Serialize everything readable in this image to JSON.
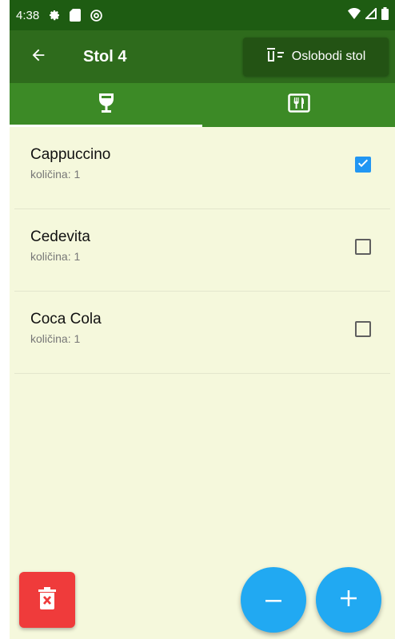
{
  "status_bar": {
    "time": "4:38",
    "left_icons": [
      "gear-icon",
      "sd-card-icon",
      "at-sign-icon"
    ],
    "right_icons": [
      "wifi-icon",
      "signal-icon",
      "battery-icon"
    ]
  },
  "app_bar": {
    "title": "Stol 4",
    "back_icon": "arrow-left-icon",
    "free_table_label": "Oslobodi stol"
  },
  "tabs": [
    {
      "icon": "wine-glass-icon",
      "active": true
    },
    {
      "icon": "restaurant-menu-icon",
      "active": false
    }
  ],
  "items": [
    {
      "name": "Cappuccino",
      "quantity": "količina: 1",
      "checked": true
    },
    {
      "name": "Cedevita",
      "quantity": "količina: 1",
      "checked": false
    },
    {
      "name": "Coca Cola",
      "quantity": "količina: 1",
      "checked": false
    }
  ],
  "colors": {
    "status_bar": "#1e5c12",
    "app_bar": "#2e6b1c",
    "tab_bar": "#3c8a26",
    "background": "#f5f8dc",
    "checkbox_checked": "#2196f3",
    "delete_button": "#ef3b3b",
    "fab": "#21a9f2"
  }
}
